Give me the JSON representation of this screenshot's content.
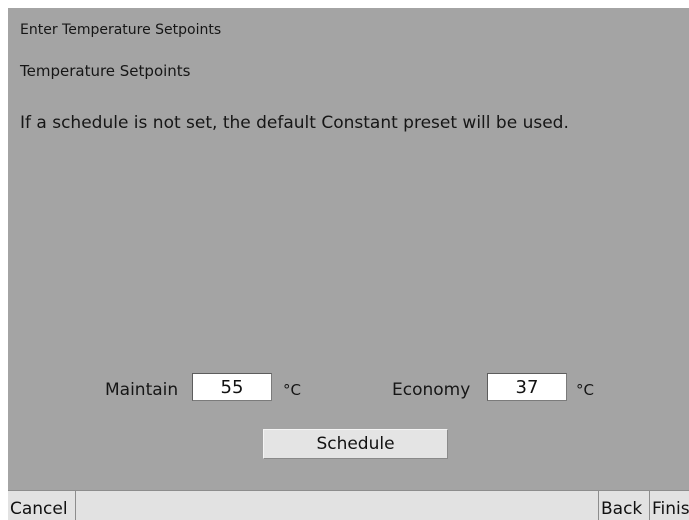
{
  "header": {
    "title": "Enter Temperature Setpoints"
  },
  "main": {
    "section_title": "Temperature Setpoints",
    "info_text": "If a schedule is not set, the default Constant preset will be used.",
    "maintain": {
      "label": "Maintain",
      "value": "55",
      "unit": "°C"
    },
    "economy": {
      "label": "Economy",
      "value": "37",
      "unit": "°C"
    },
    "schedule_label": "Schedule"
  },
  "footer": {
    "cancel_label": "Cancel",
    "back_label": "Back",
    "finish_label": "Finis"
  },
  "colors": {
    "screen_background": "#a4a4a4",
    "button_bar": "#e2e2e2",
    "input_background": "#ffffff"
  }
}
